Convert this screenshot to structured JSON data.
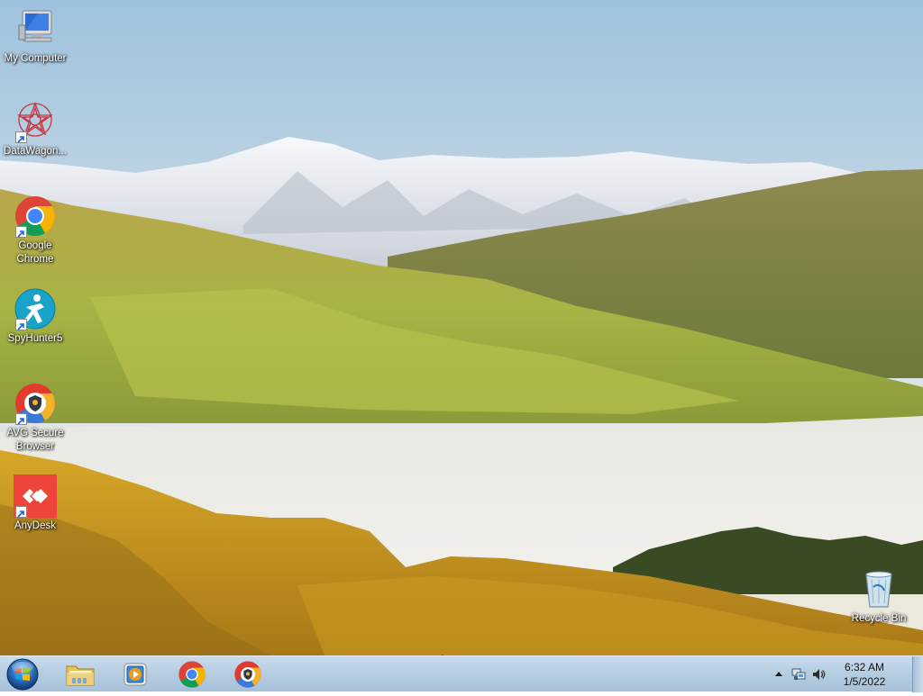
{
  "desktop": {
    "icons": [
      {
        "label": "My Computer",
        "icon": "computer-icon"
      },
      {
        "label": "DataWagon...",
        "icon": "datawagon-icon"
      },
      {
        "label": "Google Chrome",
        "icon": "chrome-icon"
      },
      {
        "label": "SpyHunter5",
        "icon": "spyhunter-icon"
      },
      {
        "label": "AVG Secure Browser",
        "icon": "avg-browser-icon"
      },
      {
        "label": "AnyDesk",
        "icon": "anydesk-icon"
      },
      {
        "label": "Recycle Bin",
        "icon": "recycle-bin-icon"
      }
    ]
  },
  "taskbar": {
    "start_icon": "windows-logo-icon",
    "pinned": [
      {
        "name": "Windows Explorer",
        "icon": "folder-icon"
      },
      {
        "name": "Windows Media Player",
        "icon": "media-player-icon"
      },
      {
        "name": "Google Chrome",
        "icon": "chrome-icon"
      },
      {
        "name": "AVG Secure Browser",
        "icon": "avg-browser-icon"
      }
    ],
    "tray": {
      "icons": [
        "chevron-up-icon",
        "network-icon",
        "volume-icon"
      ],
      "time": "6:32 AM",
      "date": "1/5/2022"
    }
  },
  "colors": {
    "taskbar": "#b7cee2",
    "chrome_red": "#db4437",
    "chrome_green": "#0f9d58",
    "chrome_yellow": "#f4b400",
    "chrome_blue": "#4285f4",
    "anydesk_red": "#ef443b",
    "spyhunter_teal": "#1aa3c8"
  }
}
